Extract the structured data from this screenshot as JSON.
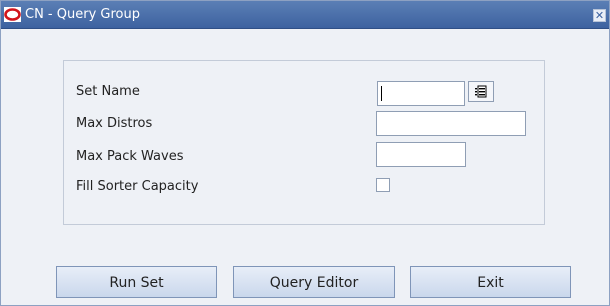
{
  "window": {
    "title": "CN - Query Group",
    "close_symbol": "✕",
    "logo_icon": "oracle-logo-icon",
    "accent_color": "#3d62a0"
  },
  "form": {
    "set_name_label": "Set Name",
    "set_name_value": "",
    "max_distros_label": "Max Distros",
    "max_distros_value": "",
    "max_pack_waves_label": "Max Pack Waves",
    "max_pack_waves_value": "",
    "fill_sorter_capacity_label": "Fill Sorter Capacity",
    "fill_sorter_capacity_checked": false,
    "list_of_values_icon": "list-icon"
  },
  "buttons": {
    "run_set": "Run Set",
    "query_editor": "Query Editor",
    "exit": "Exit"
  }
}
